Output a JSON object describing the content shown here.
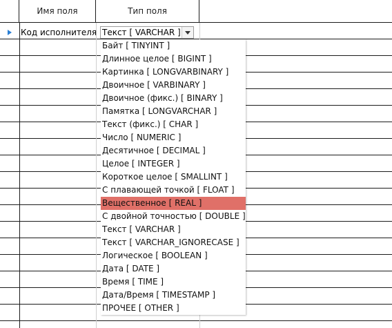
{
  "columns": {
    "field_name": "Имя поля",
    "field_type": "Тип поля"
  },
  "row": {
    "field_name": "Код исполнителя",
    "field_type": "Текст [ VARCHAR ]"
  },
  "dropdown": {
    "selected_index": 12,
    "highlight_color": "#e07068",
    "options": [
      "Байт [ TINYINT ]",
      "Длинное целое [ BIGINT ]",
      "Картинка [ LONGVARBINARY ]",
      "Двоичное [ VARBINARY ]",
      "Двоичное (фикс.) [ BINARY ]",
      "Памятка [ LONGVARCHAR ]",
      "Текст (фикс.) [ CHAR ]",
      "Число [ NUMERIC ]",
      "Десятичное [ DECIMAL ]",
      "Целое [ INTEGER ]",
      "Короткое целое [ SMALLINT ]",
      "С плавающей точкой [ FLOAT ]",
      "Вещественное [ REAL ]",
      "С двойной точностью [ DOUBLE ]",
      "Текст [ VARCHAR ]",
      "Текст [ VARCHAR_IGNORECASE ]",
      "Логическое [ BOOLEAN ]",
      "Дата [ DATE ]",
      "Время [ TIME ]",
      "Дата/Время [ TIMESTAMP ]",
      "ПРОЧЕЕ [ OTHER ]"
    ]
  }
}
